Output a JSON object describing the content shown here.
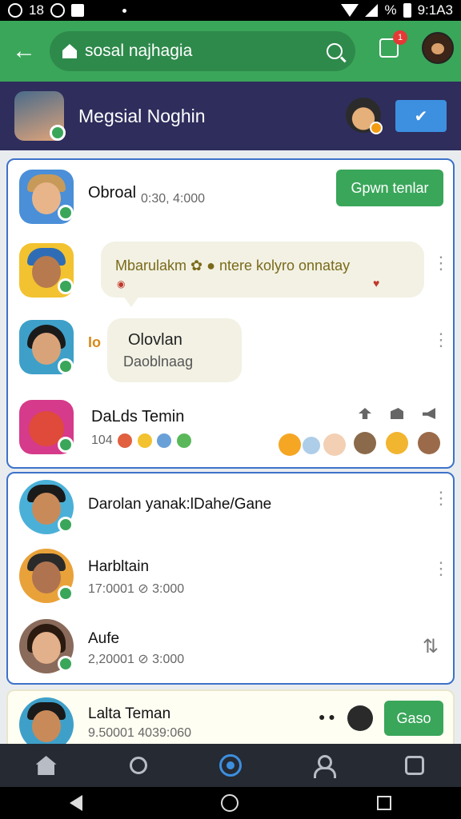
{
  "status_bar": {
    "time_left": "18",
    "time_right": "9:1A3",
    "battery": "%"
  },
  "app_bar": {
    "search_text": "sosal najhagia",
    "notification_count": "1"
  },
  "header": {
    "title": "Megsial Noghin"
  },
  "card1": {
    "rows": [
      {
        "name": "Obroal",
        "time": "0:30, 4:000",
        "button": "Gpwn tenlar"
      },
      {
        "bubble_text": "Mbarulakm ✿ ● ntere kolyro onnatay"
      },
      {
        "prefix": "Io",
        "bubble_title": "Olovlan",
        "bubble_sub": "Daoblnaag"
      },
      {
        "name": "DaLds Temin",
        "sub": "104"
      }
    ]
  },
  "card2": {
    "rows": [
      {
        "name": "Darolan yanak:lDahe/Gane"
      },
      {
        "name": "Harbltain",
        "sub": "17:0001 ⊘ 3:000"
      },
      {
        "name": "Aufe",
        "sub": "2,20001 ⊘ 3:000"
      }
    ]
  },
  "card3": {
    "name": "Lalta Teman",
    "sub": "9.50001 4039:060",
    "button": "Gaso"
  },
  "colors": {
    "accent_green": "#3aa65a",
    "header_navy": "#2e2d5c",
    "primary_blue": "#3d8fe0"
  }
}
